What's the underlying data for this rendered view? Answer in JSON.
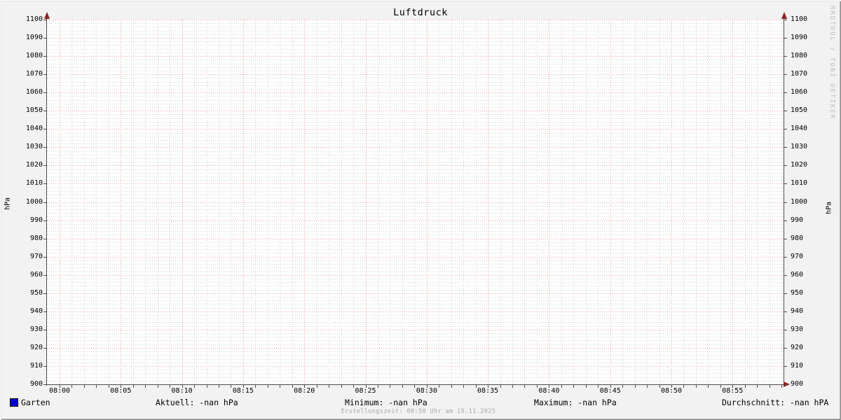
{
  "title": "Luftdruck",
  "watermark": "RRDTOOL / TOBI OETIKER",
  "footer": "Erstellungszeit: 08:50 Uhr am 19.11.2025",
  "axis": {
    "y_unit_left": "hPa",
    "y_unit_right": "hPa",
    "y_ticks": [
      "1100",
      "1090",
      "1080",
      "1070",
      "1060",
      "1050",
      "1040",
      "1030",
      "1020",
      "1010",
      "1000",
      "990",
      "980",
      "970",
      "960",
      "950",
      "940",
      "930",
      "920",
      "910",
      "900"
    ],
    "x_ticks": [
      "08:00",
      "08:05",
      "08:10",
      "08:15",
      "08:20",
      "08:25",
      "08:30",
      "08:35",
      "08:40",
      "08:45",
      "08:50",
      "08:55"
    ]
  },
  "legend": {
    "series_label": "Garten",
    "series_color": "#0000c8",
    "aktuell": "Aktuell: -nan hPa",
    "minimum": "Minimum: -nan hPa",
    "maximum": "Maximum: -nan hPa",
    "durchschnitt": "Durchschnitt: -nan hPA"
  },
  "chart_data": {
    "type": "line",
    "title": "Luftdruck",
    "xlabel": "",
    "ylabel": "hPa",
    "ylim": [
      900,
      1100
    ],
    "y_tick_step": 10,
    "x_range": [
      "08:00",
      "08:55"
    ],
    "x_tick_step_minutes": 5,
    "x_minor_step_minutes": 1,
    "grid": true,
    "legend_position": "bottom",
    "series": [
      {
        "name": "Garten",
        "color": "#0000c8",
        "values": [],
        "stats": {
          "aktuell": "-nan hPa",
          "minimum": "-nan hPa",
          "maximum": "-nan hPa",
          "durchschnitt": "-nan hPA"
        }
      }
    ]
  },
  "colors": {
    "background": "#f2f2f2",
    "canvas": "#ffffff",
    "grid_major": "#f2a2a2",
    "grid_minor": "#d4d4d4",
    "axis": "#4d4d4d",
    "arrow": "#8b2222",
    "text": "#000000",
    "footer_text": "#a8a8a8",
    "watermark_text": "#bcbcbc"
  }
}
